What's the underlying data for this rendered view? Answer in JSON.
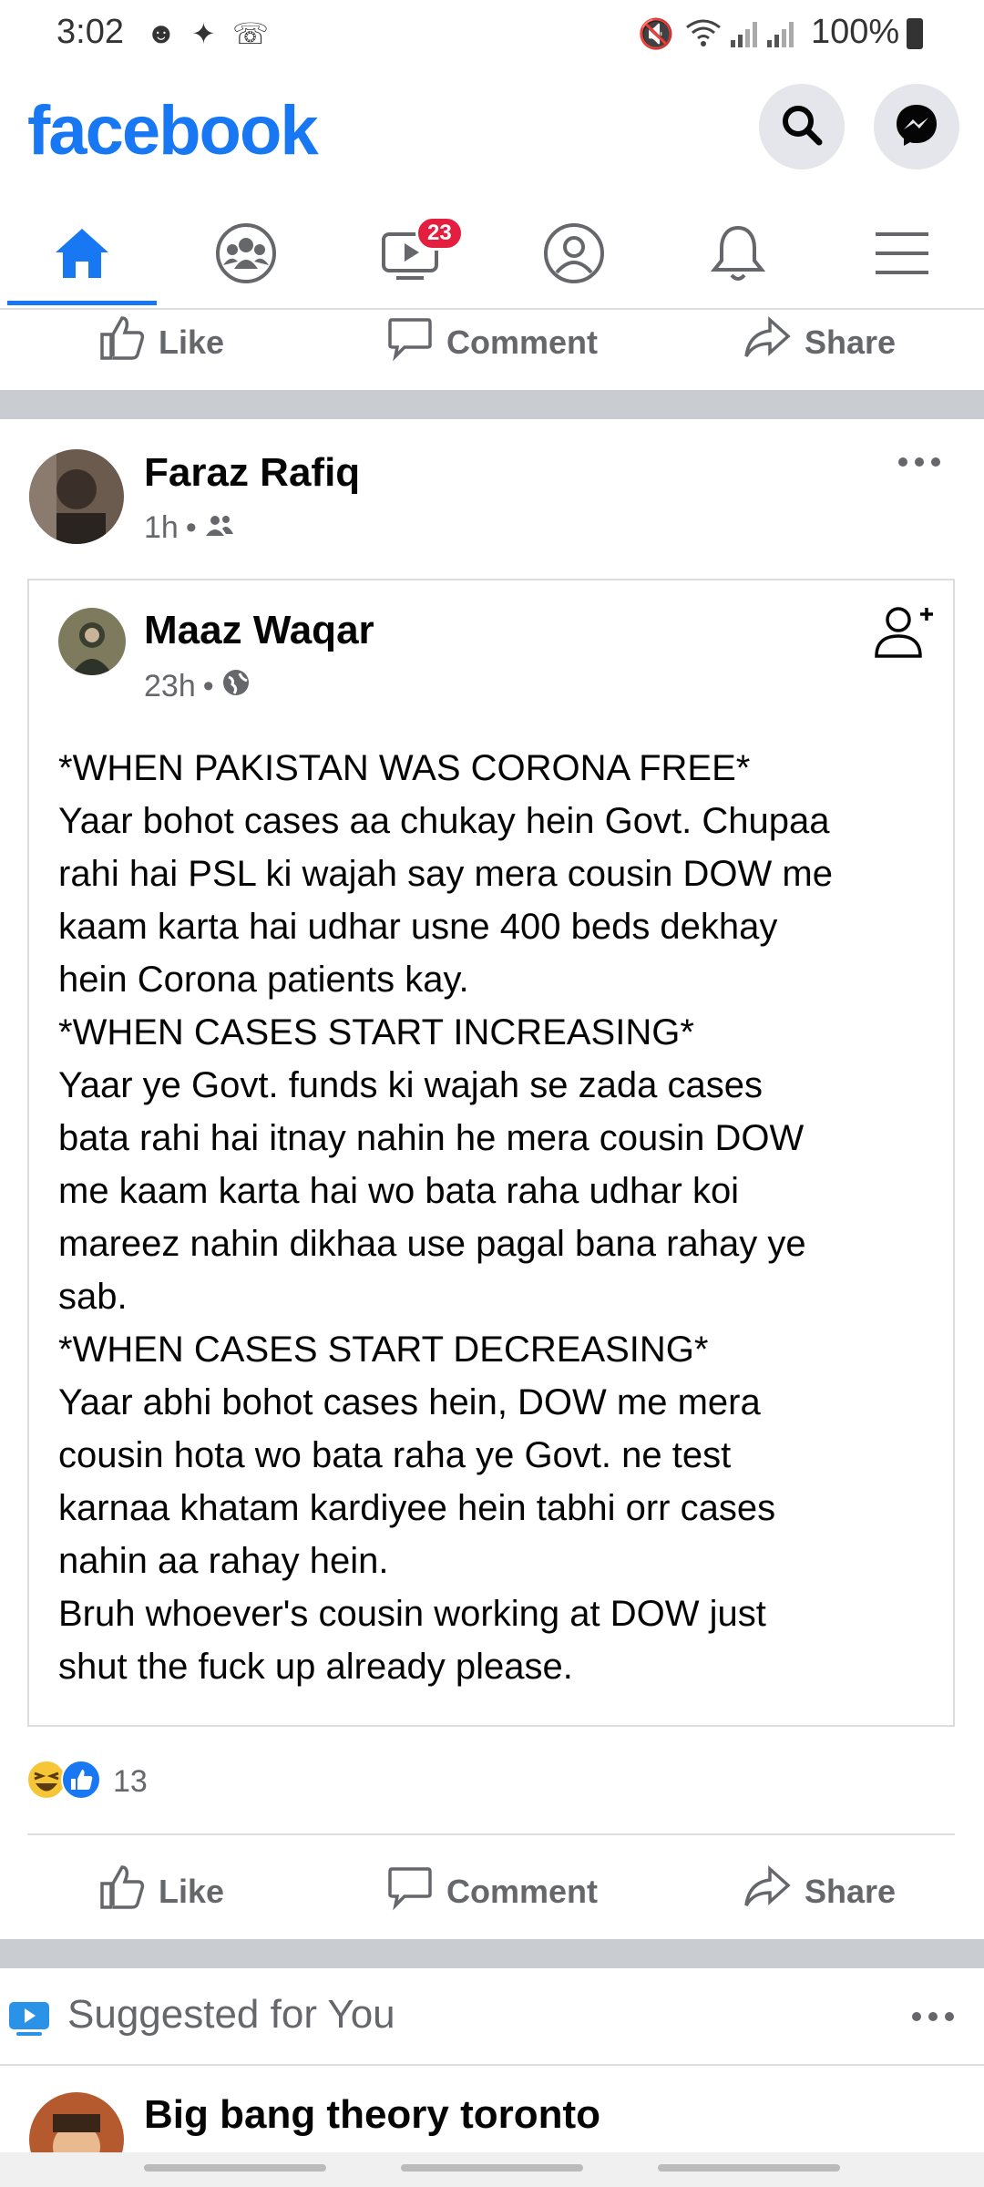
{
  "status_bar": {
    "time": "3:02",
    "battery": "100%"
  },
  "header": {
    "logo": "facebook",
    "search_icon": "search-icon",
    "messenger_icon": "messenger-icon"
  },
  "nav": {
    "tabs": [
      {
        "name": "home",
        "icon": "home-icon",
        "active": true
      },
      {
        "name": "groups",
        "icon": "groups-icon"
      },
      {
        "name": "watch",
        "icon": "video-icon",
        "badge": "23"
      },
      {
        "name": "profile",
        "icon": "profile-icon"
      },
      {
        "name": "notifications",
        "icon": "bell-icon"
      },
      {
        "name": "menu",
        "icon": "menu-icon"
      }
    ]
  },
  "top_actions": {
    "like": "Like",
    "comment": "Comment",
    "share": "Share"
  },
  "post": {
    "author": "Faraz Rafiq",
    "time": "1h",
    "shared": {
      "author": "Maaz Waqar",
      "time": "23h",
      "lines": [
        "*WHEN PAKISTAN WAS CORONA FREE*",
        "Yaar bohot cases aa chukay hein Govt. Chupaa",
        "rahi hai PSL ki wajah say mera cousin DOW me",
        "kaam karta hai udhar usne 400 beds dekhay",
        "hein Corona patients kay.",
        "*WHEN CASES START INCREASING*",
        "Yaar ye Govt. funds ki wajah se zada cases",
        "bata rahi hai itnay nahin he mera cousin DOW",
        "me kaam karta hai wo bata raha udhar koi",
        "mareez nahin dikhaa use pagal bana rahay ye",
        "sab.",
        "*WHEN CASES START DECREASING*",
        "Yaar abhi bohot cases hein, DOW me mera",
        "cousin hota wo bata raha ye Govt. ne test",
        "karnaa khatam kardiyee hein tabhi orr cases",
        "nahin aa rahay hein.",
        "Bruh whoever's cousin working at DOW just",
        "shut the fuck up already please."
      ]
    },
    "reactions_count": "13",
    "actions": {
      "like": "Like",
      "comment": "Comment",
      "share": "Share"
    }
  },
  "suggested": {
    "title": "Suggested for You",
    "first_item": "Big bang theory toronto"
  },
  "colors": {
    "brand": "#1877f2",
    "badge": "#e41e3f"
  }
}
